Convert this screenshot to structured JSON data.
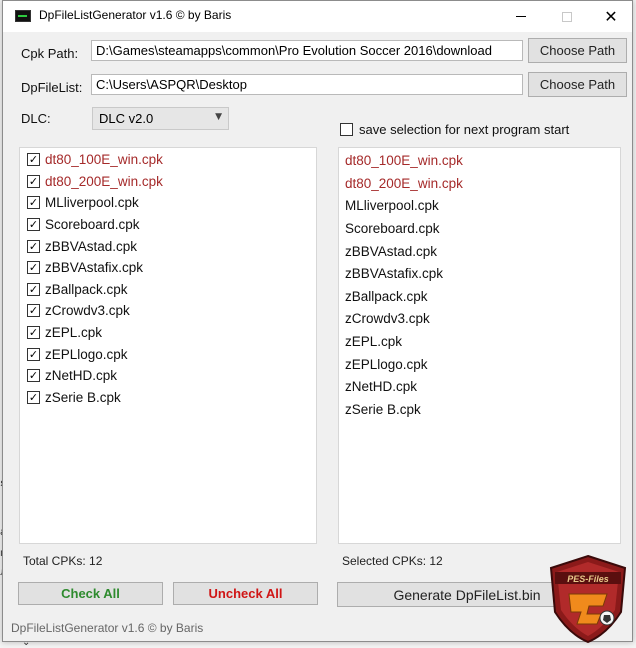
{
  "window": {
    "title": "DpFileListGenerator v1.6 © by Baris"
  },
  "cpk_path": {
    "label": "Cpk Path:",
    "value": "D:\\Games\\steamapps\\common\\Pro Evolution Soccer 2016\\download",
    "button": "Choose Path"
  },
  "dpfilelist": {
    "label": "DpFileList:",
    "value": "C:\\Users\\ASPQR\\Desktop",
    "button": "Choose Path"
  },
  "dlc": {
    "label": "DLC:",
    "selected": "DLC v2.0"
  },
  "save_selection": {
    "label": "save selection for next program start",
    "checked": false
  },
  "left_list": {
    "items": [
      {
        "label": "dt80_100E_win.cpk",
        "checked": true,
        "highlight": true
      },
      {
        "label": "dt80_200E_win.cpk",
        "checked": true,
        "highlight": true
      },
      {
        "label": "MLliverpool.cpk",
        "checked": true,
        "highlight": false
      },
      {
        "label": "Scoreboard.cpk",
        "checked": true,
        "highlight": false
      },
      {
        "label": "zBBVAstad.cpk",
        "checked": true,
        "highlight": false
      },
      {
        "label": "zBBVAstafix.cpk",
        "checked": true,
        "highlight": false
      },
      {
        "label": "zBallpack.cpk",
        "checked": true,
        "highlight": false
      },
      {
        "label": "zCrowdv3.cpk",
        "checked": true,
        "highlight": false
      },
      {
        "label": "zEPL.cpk",
        "checked": true,
        "highlight": false
      },
      {
        "label": "zEPLlogo.cpk",
        "checked": true,
        "highlight": false
      },
      {
        "label": "zNetHD.cpk",
        "checked": true,
        "highlight": false
      },
      {
        "label": "zSerie B.cpk",
        "checked": true,
        "highlight": false
      }
    ],
    "total_label": "Total CPKs: 12"
  },
  "right_list": {
    "items": [
      {
        "label": "dt80_100E_win.cpk",
        "highlight": true
      },
      {
        "label": "dt80_200E_win.cpk",
        "highlight": true
      },
      {
        "label": "MLliverpool.cpk",
        "highlight": false
      },
      {
        "label": "Scoreboard.cpk",
        "highlight": false
      },
      {
        "label": "zBBVAstad.cpk",
        "highlight": false
      },
      {
        "label": "zBBVAstafix.cpk",
        "highlight": false
      },
      {
        "label": "zBallpack.cpk",
        "highlight": false
      },
      {
        "label": "zCrowdv3.cpk",
        "highlight": false
      },
      {
        "label": "zEPL.cpk",
        "highlight": false
      },
      {
        "label": "zEPLlogo.cpk",
        "highlight": false
      },
      {
        "label": "zNetHD.cpk",
        "highlight": false
      },
      {
        "label": "zSerie B.cpk",
        "highlight": false
      }
    ],
    "selected_label": "Selected CPKs: 12"
  },
  "buttons": {
    "check_all": "Check All",
    "uncheck_all": "Uncheck All",
    "generate": "Generate DpFileList.bin"
  },
  "status": "DpFileListGenerator v1.6 © by Baris",
  "logo": {
    "text": "PES-Files"
  },
  "colors": {
    "highlight_red": "#a52a2a",
    "check_all_green": "#2e8b2e",
    "uncheck_all_red": "#d01515"
  }
}
